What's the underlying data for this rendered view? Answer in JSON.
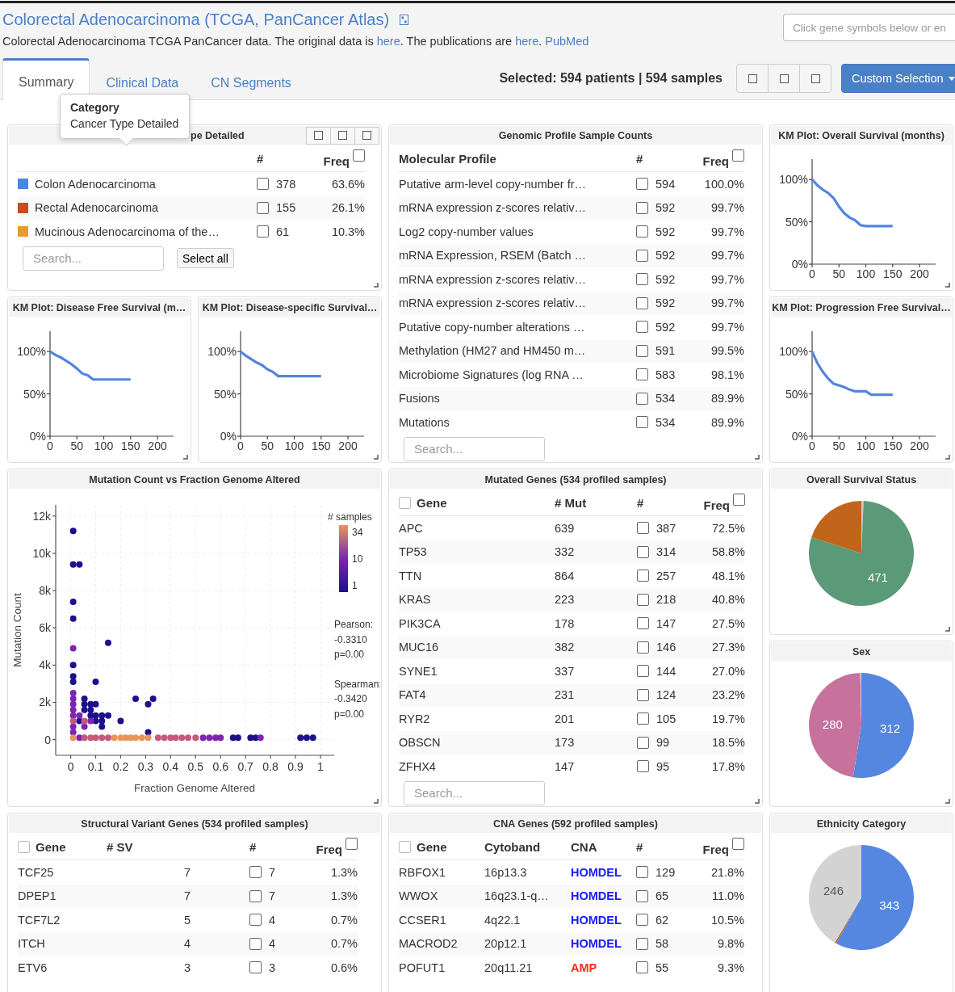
{
  "header": {
    "title": "Colorectal Adenocarcinoma (TCGA, PanCancer Atlas)",
    "description": [
      {
        "text": "Colorectal Adenocarcinoma TCGA PanCancer data. The original data is ",
        "link": "here"
      },
      {
        "text": ". The publications are ",
        "link": "here"
      },
      {
        "text": ". ",
        "link": "PubMed"
      }
    ],
    "gene_search": {
      "placeholder": "Click gene symbols below or en"
    }
  },
  "tabs": [
    {
      "label": "Summary",
      "selected": true
    },
    {
      "label": "Clinical Data",
      "selected": false
    },
    {
      "label": "CN Segments",
      "selected": false
    }
  ],
  "selection_summary": "Selected: 594 patients | 594 samples",
  "custom_selection": {
    "label": "Custom Selection"
  },
  "panels": [
    {
      "kind": "category_table",
      "title": "pe Detailed",
      "tooltip": {
        "title": "Category",
        "text": "Cancer Type Detailed"
      },
      "columns": [
        "#",
        "Freq"
      ],
      "freq_checked": false,
      "rows": [
        {
          "color": "#4a86e8",
          "cells": [
            "Colon Adenocarcinoma"
          ],
          "checked": false,
          "count": "378",
          "freq": "63.6%"
        },
        {
          "color": "#cc4a1c",
          "cells": [
            "Rectal Adenocarcinoma"
          ],
          "checked": false,
          "count": "155",
          "freq": "26.1%"
        },
        {
          "color": "#ee9a2a",
          "cells": [
            "Mucinous Adenocarcinoma of the…"
          ],
          "checked": false,
          "count": "61",
          "freq": "10.3%"
        }
      ],
      "search": {
        "placeholder": "Search..."
      },
      "select_all": "Select all"
    },
    {
      "kind": "profile_table",
      "title": "Genomic Profile Sample Counts",
      "columns": [
        "Molecular Profile",
        "#",
        "Freq"
      ],
      "freq_checked": false,
      "rows": [
        {
          "cells": [
            "Putative arm-level copy-number fr…"
          ],
          "checked": false,
          "count": "594",
          "freq": "100.0%"
        },
        {
          "cells": [
            "mRNA expression z-scores relativ…"
          ],
          "checked": false,
          "count": "592",
          "freq": "99.7%"
        },
        {
          "cells": [
            "Log2 copy-number values"
          ],
          "checked": false,
          "count": "592",
          "freq": "99.7%"
        },
        {
          "cells": [
            "mRNA Expression, RSEM (Batch …"
          ],
          "checked": false,
          "count": "592",
          "freq": "99.7%"
        },
        {
          "cells": [
            "mRNA expression z-scores relativ…"
          ],
          "checked": false,
          "count": "592",
          "freq": "99.7%"
        },
        {
          "cells": [
            "mRNA expression z-scores relativ…"
          ],
          "checked": false,
          "count": "592",
          "freq": "99.7%"
        },
        {
          "cells": [
            "Putative copy-number alterations …"
          ],
          "checked": false,
          "count": "592",
          "freq": "99.7%"
        },
        {
          "cells": [
            "Methylation (HM27 and HM450 m…"
          ],
          "checked": false,
          "count": "591",
          "freq": "99.5%"
        },
        {
          "cells": [
            "Microbiome Signatures (log RNA …"
          ],
          "checked": false,
          "count": "583",
          "freq": "98.1%"
        },
        {
          "cells": [
            "Fusions"
          ],
          "checked": false,
          "count": "534",
          "freq": "89.9%"
        },
        {
          "cells": [
            "Mutations"
          ],
          "checked": false,
          "count": "534",
          "freq": "89.9%"
        }
      ],
      "search": {
        "placeholder": "Search..."
      }
    },
    {
      "kind": "km_plot",
      "title": "KM Plot: Overall Survival (months)",
      "chart_data": {
        "type": "line",
        "xlim": [
          0,
          230
        ],
        "ylim": [
          0,
          1.24
        ],
        "x": [
          0,
          10,
          20,
          30,
          40,
          50,
          60,
          70,
          80,
          90,
          100,
          150
        ],
        "series": [
          {
            "color": "#5385de",
            "values": [
              1,
              0.93,
              0.88,
              0.84,
              0.78,
              0.68,
              0.6,
              0.55,
              0.52,
              0.46,
              0.45,
              0.45
            ]
          }
        ],
        "xticks": [
          0,
          50,
          100,
          150,
          200
        ],
        "yticks": [
          {
            "value": 0,
            "label": "0%"
          },
          {
            "value": 0.5,
            "label": "50%"
          },
          {
            "value": 1,
            "label": "100%"
          }
        ]
      }
    },
    {
      "kind": "km_plot",
      "title": "KM Plot: Disease Free Survival (m…",
      "chart_data": {
        "type": "line",
        "xlim": [
          0,
          230
        ],
        "ylim": [
          0,
          1.24
        ],
        "x": [
          0,
          10,
          20,
          30,
          40,
          50,
          60,
          70,
          80,
          90,
          110,
          130,
          150
        ],
        "series": [
          {
            "color": "#5385de",
            "values": [
              1,
              0.96,
              0.93,
              0.89,
              0.85,
              0.8,
              0.74,
              0.72,
              0.67,
              0.67,
              0.67,
              0.67,
              0.67
            ]
          }
        ],
        "xticks": [
          0,
          50,
          100,
          150,
          200
        ],
        "yticks": [
          {
            "value": 0,
            "label": "0%"
          },
          {
            "value": 0.5,
            "label": "50%"
          },
          {
            "value": 1,
            "label": "100%"
          }
        ]
      }
    },
    {
      "kind": "km_plot",
      "title": "KM Plot: Disease-specific Survival…",
      "chart_data": {
        "type": "line",
        "xlim": [
          0,
          230
        ],
        "ylim": [
          0,
          1.24
        ],
        "x": [
          0,
          10,
          20,
          30,
          40,
          50,
          60,
          70,
          150
        ],
        "series": [
          {
            "color": "#5385de",
            "values": [
              1,
              0.95,
              0.91,
              0.87,
              0.84,
              0.79,
              0.76,
              0.71,
              0.71
            ]
          }
        ],
        "xticks": [
          0,
          50,
          100,
          150,
          200
        ],
        "yticks": [
          {
            "value": 0,
            "label": "0%"
          },
          {
            "value": 0.5,
            "label": "50%"
          },
          {
            "value": 1,
            "label": "100%"
          }
        ]
      }
    },
    {
      "kind": "km_plot",
      "title": "KM Plot: Progression Free Survival…",
      "chart_data": {
        "type": "line",
        "xlim": [
          0,
          230
        ],
        "ylim": [
          0,
          1.24
        ],
        "x": [
          0,
          10,
          20,
          30,
          40,
          50,
          60,
          70,
          80,
          100,
          110,
          150
        ],
        "series": [
          {
            "color": "#5385de",
            "values": [
              1,
              0.86,
              0.76,
              0.68,
              0.62,
              0.6,
              0.58,
              0.55,
              0.53,
              0.53,
              0.49,
              0.49
            ]
          }
        ],
        "xticks": [
          0,
          50,
          100,
          150,
          200
        ],
        "yticks": [
          {
            "value": 0,
            "label": "0%"
          },
          {
            "value": 0.5,
            "label": "50%"
          },
          {
            "value": 1,
            "label": "100%"
          }
        ]
      }
    },
    {
      "kind": "scatter",
      "title": "Mutation Count vs Fraction Genome Altered",
      "color_scale": {
        "title": "# samples",
        "labels": [
          "34",
          "10",
          "1"
        ]
      },
      "chart_data": {
        "type": "scatter",
        "xlabel": "Fraction Genome Altered",
        "ylabel": "Mutation Count",
        "xlim": [
          -0.06,
          1.055
        ],
        "ylim": [
          -840,
          12600
        ],
        "grid": true,
        "xticks": [
          0,
          0.1,
          0.2,
          0.3,
          0.4,
          0.5,
          0.6,
          0.7,
          0.8,
          0.9,
          1
        ],
        "yticks": [
          {
            "value": 0,
            "label": "0"
          },
          {
            "value": 2000,
            "label": "2k"
          },
          {
            "value": 4000,
            "label": "4k"
          },
          {
            "value": 6000,
            "label": "6k"
          },
          {
            "value": 8000,
            "label": "8k"
          },
          {
            "value": 10000,
            "label": "10k"
          },
          {
            "value": 12000,
            "label": "12k"
          }
        ],
        "series": [
          {
            "color": "#1c108c",
            "x": [
              0.01,
              0.01,
              0.035,
              0.01,
              0.01,
              0.01,
              0.01,
              0.01,
              0.15,
              0.1,
              0.055,
              0.055,
              0.055,
              0.08,
              0.08,
              0.08,
              0.1,
              0.1,
              0.1,
              0.125,
              0.125,
              0.125,
              0.15,
              0.035,
              0.2,
              0.26,
              0.31,
              0.33,
              0.31,
              0.65,
              0.67,
              0.72,
              0.74,
              0.92,
              0.945,
              0.97
            ],
            "values": [
              11200,
              9400,
              9400,
              7400,
              6500,
              4000,
              3400,
              3100,
              5200,
              3100,
              2200,
              1900,
              1600,
              1900,
              1600,
              1300,
              1900,
              1300,
              1000,
              1300,
              1000,
              700,
              1300,
              1000,
              1000,
              2200,
              1900,
              2200,
              400,
              100,
              100,
              100,
              100,
              100,
              100,
              100
            ]
          },
          {
            "color": "#7d24b2",
            "x": [
              0.01,
              0.01,
              0.01,
              0.01,
              0.01,
              0.01,
              0.01,
              0.01,
              0.035,
              0.055,
              0.08,
              0.035,
              0.53,
              0.555,
              0.58,
              0.6,
              0.76
            ],
            "values": [
              4900,
              2500,
              2200,
              1900,
              1600,
              1300,
              700,
              400,
              1300,
              700,
              1000,
              100,
              100,
              100,
              100,
              100,
              100
            ]
          },
          {
            "color": "#c6587c",
            "x": [
              0.01,
              0.055,
              0.055,
              0.08,
              0.1,
              0.125,
              0.15,
              0.35,
              0.375,
              0.4,
              0.42,
              0.445,
              0.47,
              0.5
            ],
            "values": [
              1000,
              1000,
              100,
              100,
              100,
              100,
              100,
              100,
              100,
              100,
              100,
              100,
              100,
              100
            ]
          },
          {
            "color": "#e8955a",
            "x": [
              0.01,
              0.175,
              0.2,
              0.22,
              0.24,
              0.26,
              0.285,
              0.31
            ],
            "values": [
              100,
              100,
              100,
              100,
              100,
              100,
              100,
              100
            ]
          }
        ],
        "annotations": [
          "Pearson:",
          "-0.3310",
          "p=0.00",
          "Spearman:",
          "-0.3420",
          "p=0.00"
        ]
      }
    },
    {
      "kind": "gene_table",
      "title": "Mutated Genes (534 profiled samples)",
      "columns": [
        "Gene",
        "# Mut",
        "#",
        "Freq"
      ],
      "gene_checked": false,
      "freq_checked": false,
      "rows": [
        {
          "cells": [
            "APC",
            "639"
          ],
          "checked": false,
          "count": "387",
          "freq": "72.5%"
        },
        {
          "cells": [
            "TP53",
            "332"
          ],
          "checked": false,
          "count": "314",
          "freq": "58.8%"
        },
        {
          "cells": [
            "TTN",
            "864"
          ],
          "checked": false,
          "count": "257",
          "freq": "48.1%"
        },
        {
          "cells": [
            "KRAS",
            "223"
          ],
          "checked": false,
          "count": "218",
          "freq": "40.8%"
        },
        {
          "cells": [
            "PIK3CA",
            "178"
          ],
          "checked": false,
          "count": "147",
          "freq": "27.5%"
        },
        {
          "cells": [
            "MUC16",
            "382"
          ],
          "checked": false,
          "count": "146",
          "freq": "27.3%"
        },
        {
          "cells": [
            "SYNE1",
            "337"
          ],
          "checked": false,
          "count": "144",
          "freq": "27.0%"
        },
        {
          "cells": [
            "FAT4",
            "231"
          ],
          "checked": false,
          "count": "124",
          "freq": "23.2%"
        },
        {
          "cells": [
            "RYR2",
            "201"
          ],
          "checked": false,
          "count": "105",
          "freq": "19.7%"
        },
        {
          "cells": [
            "OBSCN",
            "173"
          ],
          "checked": false,
          "count": "99",
          "freq": "18.5%"
        },
        {
          "cells": [
            "ZFHX4",
            "147"
          ],
          "checked": false,
          "count": "95",
          "freq": "17.8%"
        }
      ],
      "search": {
        "placeholder": "Search..."
      }
    },
    {
      "kind": "pie",
      "title": "Overall Survival Status",
      "chart_data": {
        "type": "pie",
        "values": [
          4,
          471,
          119
        ],
        "colors": [
          "#cccccc",
          "#5a9a78",
          "#c1651a"
        ],
        "value_labels": [
          null,
          "471",
          null
        ]
      }
    },
    {
      "kind": "pie",
      "title": "Sex",
      "chart_data": {
        "type": "pie",
        "values": [
          312,
          280,
          2
        ],
        "colors": [
          "#5586e0",
          "#c7719d",
          "#cccccc"
        ],
        "value_labels": [
          "312",
          "280",
          null
        ]
      }
    },
    {
      "kind": "gene_table",
      "title": "Structural Variant Genes (534 profiled samples)",
      "columns": [
        "Gene",
        "# SV",
        "#",
        "Freq"
      ],
      "gene_checked": false,
      "freq_checked": false,
      "rows": [
        {
          "cells": [
            "TCF25",
            "7"
          ],
          "checked": false,
          "count": "7",
          "freq": "1.3%"
        },
        {
          "cells": [
            "DPEP1",
            "7"
          ],
          "checked": false,
          "count": "7",
          "freq": "1.3%"
        },
        {
          "cells": [
            "TCF7L2",
            "5"
          ],
          "checked": false,
          "count": "4",
          "freq": "0.7%"
        },
        {
          "cells": [
            "ITCH",
            "4"
          ],
          "checked": false,
          "count": "4",
          "freq": "0.7%"
        },
        {
          "cells": [
            "ETV6",
            "3"
          ],
          "checked": false,
          "count": "3",
          "freq": "0.6%"
        }
      ]
    },
    {
      "kind": "gene_table",
      "title": "CNA Genes (592 profiled samples)",
      "columns": [
        "Gene",
        "Cytoband",
        "CNA",
        "#",
        "Freq"
      ],
      "gene_checked": false,
      "freq_checked": false,
      "rows": [
        {
          "cells": [
            "RBFOX1",
            "16p13.3"
          ],
          "tag": {
            "text": "HOMDEL",
            "color": "#1a1aff"
          },
          "checked": false,
          "count": "129",
          "freq": "21.8%"
        },
        {
          "cells": [
            "WWOX",
            "16q23.1-q…"
          ],
          "tag": {
            "text": "HOMDEL",
            "color": "#1a1aff"
          },
          "checked": false,
          "count": "65",
          "freq": "11.0%"
        },
        {
          "cells": [
            "CCSER1",
            "4q22.1"
          ],
          "tag": {
            "text": "HOMDEL",
            "color": "#1a1aff"
          },
          "checked": false,
          "count": "62",
          "freq": "10.5%"
        },
        {
          "cells": [
            "MACROD2",
            "20p12.1"
          ],
          "tag": {
            "text": "HOMDEL",
            "color": "#1a1aff"
          },
          "checked": false,
          "count": "58",
          "freq": "9.8%"
        },
        {
          "cells": [
            "POFUT1",
            "20q11.21"
          ],
          "tag": {
            "text": "AMP",
            "color": "#ff2a1a"
          },
          "checked": false,
          "count": "55",
          "freq": "9.3%"
        }
      ]
    },
    {
      "kind": "pie",
      "title": "Ethnicity Category",
      "chart_data": {
        "type": "pie",
        "values": [
          343,
          3,
          246
        ],
        "colors": [
          "#5586e0",
          "#c1651a",
          "#d3d3d3"
        ],
        "value_labels": [
          "343",
          null,
          "246"
        ]
      }
    }
  ]
}
